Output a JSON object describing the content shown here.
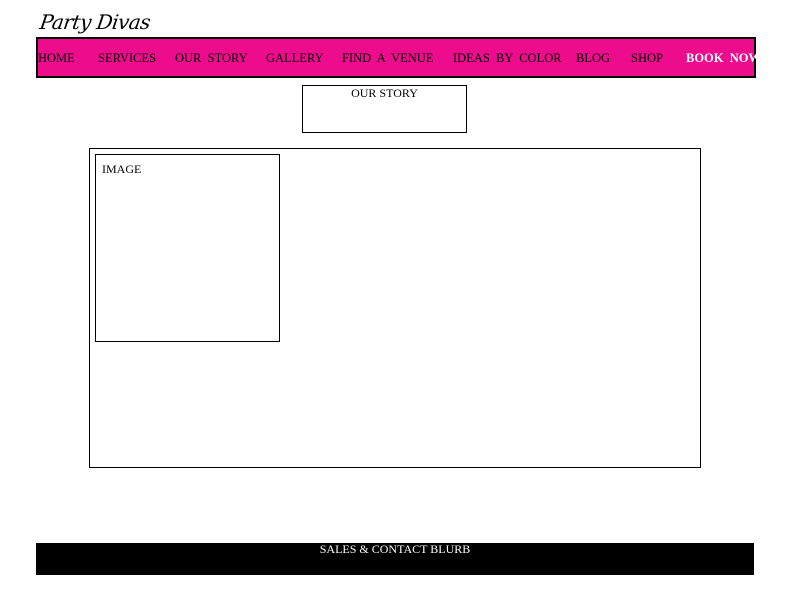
{
  "logo": {
    "text": "Party Divas"
  },
  "nav": {
    "items": [
      {
        "label": "HOME"
      },
      {
        "label": "SERVICES"
      },
      {
        "label": "OUR  STORY"
      },
      {
        "label": "GALLERY"
      },
      {
        "label": "FIND  A  VENUE"
      },
      {
        "label": "IDEAS  BY  COLOR"
      },
      {
        "label": "BLOG"
      },
      {
        "label": "SHOP"
      },
      {
        "label": "BOOK  NOW"
      }
    ]
  },
  "page": {
    "title": "OUR STORY",
    "image_label": "IMAGE"
  },
  "footer": {
    "text": "SALES & CONTACT BLURB"
  },
  "colors": {
    "nav_background": "#ec0c8c",
    "footer_background": "#000000",
    "cta_text": "#ffffff"
  }
}
